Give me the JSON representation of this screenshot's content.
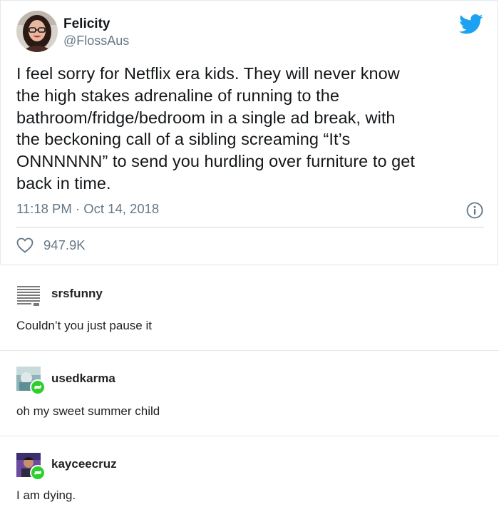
{
  "tweet": {
    "display_name": "Felicity",
    "handle": "@FlossAus",
    "text": "I feel sorry for Netflix era kids. They will never know\nthe high stakes adrenaline of running to the\nbathroom/fridge/bedroom in a single ad break, with\nthe beckoning call of a sibling screaming “It’s\nONNNNNN” to send you hurdling over furniture to get\nback in time.",
    "timestamp": "11:18 PM · Oct 14, 2018",
    "like_count": "947.9K",
    "icons": {
      "brand": "twitter-bird-icon",
      "info": "info-icon",
      "like": "heart-icon"
    },
    "colors": {
      "brand_blue": "#1da1f2",
      "meta_gray": "#657786"
    }
  },
  "comments": [
    {
      "username": "srsfunny",
      "text": "Couldn’t you just pause it",
      "reblog_badge": false
    },
    {
      "username": "usedkarma",
      "text": "oh my sweet summer child",
      "reblog_badge": true
    },
    {
      "username": "kayceecruz",
      "text": "I am dying.",
      "reblog_badge": true
    }
  ],
  "colors": {
    "reblog_green": "#2fce2f"
  }
}
